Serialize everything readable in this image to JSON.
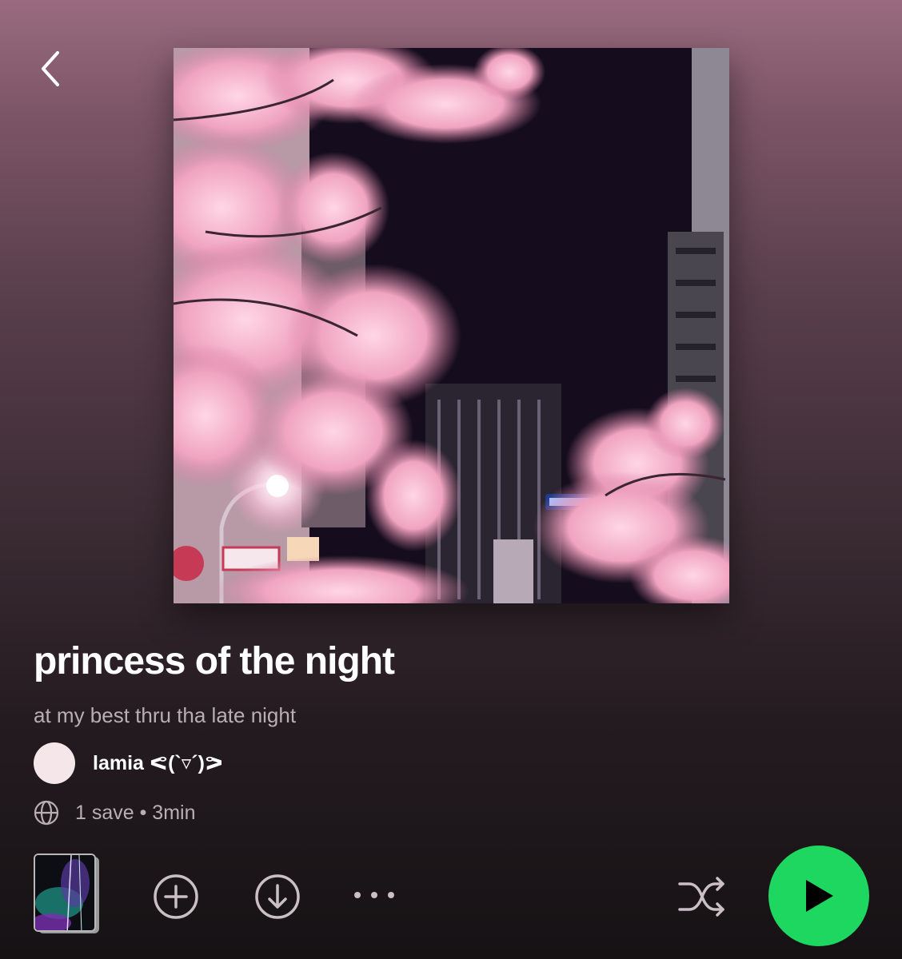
{
  "playlist": {
    "title": "princess of the night",
    "description": "at my best thru tha late night",
    "owner": "lamia ᕙ(`▿´)ᕗ",
    "meta": "1 save • 3min"
  },
  "icons": {
    "back": "chevron-left-icon",
    "public": "globe-icon",
    "add": "add-circle-icon",
    "download": "download-circle-icon",
    "more": "more-horizontal-icon",
    "shuffle": "shuffle-icon",
    "play": "play-icon"
  },
  "colors": {
    "play_button": "#1ed760",
    "avatar": "#f5e6ea",
    "secondary_text": "#b9aeb4"
  }
}
